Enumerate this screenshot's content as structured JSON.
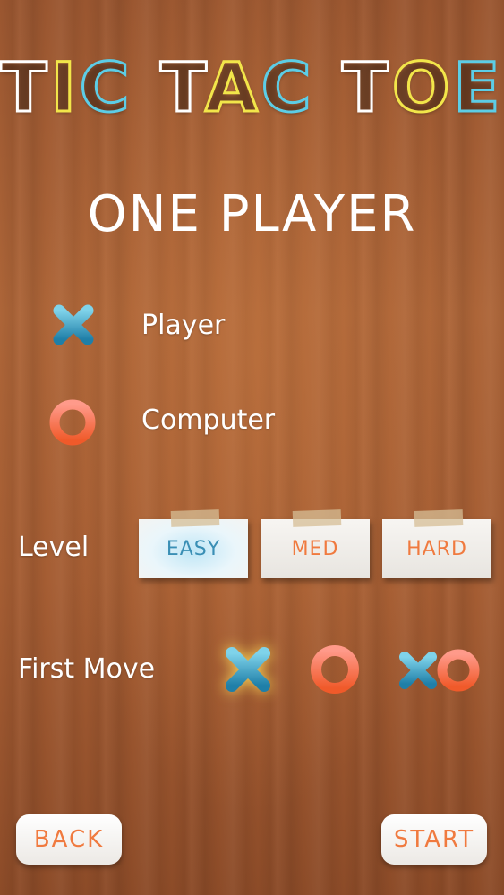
{
  "title": {
    "letters": [
      {
        "char": "T",
        "color": "#ffffff"
      },
      {
        "char": "I",
        "color": "#f2e64a"
      },
      {
        "char": "C",
        "color": "#5ccde6"
      },
      {
        "char": " ",
        "color": "#ffffff"
      },
      {
        "char": "T",
        "color": "#ffffff"
      },
      {
        "char": "A",
        "color": "#f2e64a"
      },
      {
        "char": "C",
        "color": "#5ccde6"
      },
      {
        "char": " ",
        "color": "#ffffff"
      },
      {
        "char": "T",
        "color": "#ffffff"
      },
      {
        "char": "O",
        "color": "#f2e64a"
      },
      {
        "char": "E",
        "color": "#5ccde6"
      }
    ]
  },
  "subtitle": "ONE PLAYER",
  "assignments": [
    {
      "icon": "x-icon",
      "label": "Player"
    },
    {
      "icon": "o-icon",
      "label": "Computer"
    }
  ],
  "level": {
    "label": "Level",
    "options": [
      "EASY",
      "MED",
      "HARD"
    ],
    "selected": "EASY"
  },
  "first_move": {
    "label": "First Move",
    "options": [
      "x-icon",
      "o-icon",
      "xo-icon"
    ],
    "selected": "x-icon"
  },
  "buttons": {
    "back": "BACK",
    "start": "START"
  },
  "colors": {
    "x_color": "#2f9fc4",
    "o_color": "#f26a3c",
    "button_text": "#f07a3f",
    "selected_level_text": "#3a8fb5"
  }
}
